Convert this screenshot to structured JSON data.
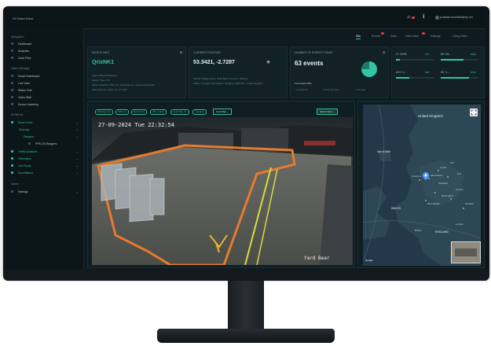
{
  "app": {
    "title": "HI Smart Drive",
    "user": "jonathan.blomfield@hp.net"
  },
  "tabs": [
    {
      "label": "Site",
      "active": true
    },
    {
      "label": "Events",
      "active": false
    },
    {
      "label": "Stats",
      "active": false
    },
    {
      "label": "Video Wall",
      "active": false
    },
    {
      "label": "Settings",
      "active": false
    },
    {
      "label": "Living Video",
      "active": false
    }
  ],
  "sidebar": {
    "sections": [
      {
        "title": "Navigation",
        "items": [
          "Dashboard",
          "Analytics",
          "Case Files"
        ]
      },
      {
        "title": "Video Manager",
        "items": [
          "Smart Dashboard",
          "Live View",
          "Status Grid",
          "Video Wall",
          "Device Inventory"
        ]
      },
      {
        "title": "Sit Menus",
        "items": [
          "Smart Drive",
          "Deeraay",
          "Rangers",
          "PPE-DS Rangers",
          "Traffic Analytics",
          "Telematics",
          "Live Route",
          "Surveillance"
        ]
      },
      {
        "title": "Admin",
        "items": [
          "Settings"
        ]
      }
    ]
  },
  "cards": {
    "device": {
      "title": "DEVICE INFO",
      "value": "QrixNK1",
      "lines": [
        "Agent PPE-DS Rangers",
        "Device Type: PTz",
        "Active Analytics: PPE, DS, Heat Map Ax, Intrusion Detection",
        "Subscriptions: Video, AI, IoT, NAT"
      ]
    },
    "position": {
      "title": "CURRENT POSITION",
      "value": "53.3421, -2.7287",
      "lines": [
        "Hall 20, Bridge Street, West Bank, Runcorn, Widnes,",
        "Halton, Liverpool City Region, England, WA8 0XL, United Kingdom"
      ]
    },
    "events": {
      "title": "NUMBER OF EVENTS TODAY",
      "value": "63 events",
      "subtitle": "Incomplete PPE",
      "legend": [
        "No helmet",
        "No hi-vis vest",
        "No vest"
      ]
    },
    "stats": {
      "rows": [
        {
          "left": "0 / 100%",
          "tag": "CPU",
          "right": "89 / 51...",
          "tag2": "MEM"
        },
        {
          "left": "613 / 1...",
          "tag": "NET",
          "right": "92 / 1...",
          "tag2": "DISK"
        }
      ]
    }
  },
  "filters": {
    "pills": [
      "Missing vest",
      "PPE vio",
      "Restricted",
      "Idle vehicle",
      "Heat Map vis",
      "Intruding",
      "Instruction"
    ],
    "dropdown": "Heat Map",
    "select": "Select Filter"
  },
  "video": {
    "timestamp": "27-09-2024 Tue 22:32:54",
    "camera_label": "Yard Bear"
  },
  "map": {
    "labels": {
      "country": "United Kingdom",
      "isle": "Isle of Man",
      "region": "WALES",
      "england": "ENGLAND",
      "attribution": "Google"
    },
    "towns": [
      "Liverpool",
      "Manchester",
      "Sheffield",
      "Leeds",
      "York",
      "Hull",
      "Birmingham",
      "Nottingham",
      "Lincoln",
      "Norwich",
      "Bristol",
      "London"
    ]
  },
  "colors": {
    "accent": "#33c4a4",
    "background": "#0e1a1f",
    "panel": "#112126",
    "boundary": "#e87a2e",
    "path": "#d9dd3a"
  }
}
